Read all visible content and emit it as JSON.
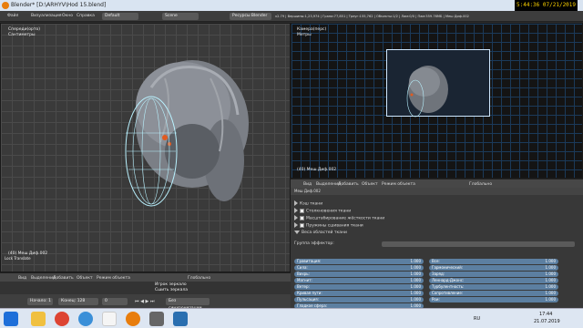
{
  "window": {
    "title": "Blender* [D:\\ARHYV\\Hod 15.blend]",
    "clock": "5:44:36  07/21/2019"
  },
  "menu": {
    "items": [
      "Файл",
      "Визуализация",
      "Окно",
      "Справка"
    ],
    "layout": "Default",
    "scene": "Scene",
    "engine": "Ресурсы Blender",
    "stats": "v2.79 | Вершины:1,23,974 | Грани:77,851 | Треуг:155,762 | Объекты:1/2 | Лам:0/0 | Пам:559.76МБ | Меш Диф.002"
  },
  "left_view": {
    "label_top": "Спереди(орто)",
    "label_sub": "Сантиметры",
    "label_object": "(40) Меш Диф.002",
    "transform_label": "Lock Translate"
  },
  "right_view": {
    "label_top": "Камера(перс)",
    "label_sub": "Метры",
    "label_object": "(40) Меш Диф.002"
  },
  "left_header": {
    "items": [
      "Вид",
      "Выделение",
      "Добавить",
      "Объект",
      "Режим объекта",
      "Глобально"
    ]
  },
  "right_header": {
    "items": [
      "Вид",
      "Выделение",
      "Добавить",
      "Объект",
      "Режим объекта",
      "Глобально"
    ]
  },
  "props": {
    "path": "Меш Диф.002",
    "sections": [
      "Кэш ткани",
      "Столкновения ткани",
      "Масштабирование жёсткости ткани",
      "Пружины сшивания ткани",
      "Веса областей ткани"
    ],
    "group_label": "Группа эффектор:",
    "fields_left": [
      {
        "label": "Гравитация:",
        "value": "1.000"
      },
      {
        "label": "Сила:",
        "value": "1.000"
      },
      {
        "label": "Вихрь:",
        "value": "1.000"
      },
      {
        "label": "Магнит:",
        "value": "1.000"
      },
      {
        "label": "Ветер:",
        "value": "1.000"
      },
      {
        "label": "Кривая пути:",
        "value": "1.000"
      },
      {
        "label": "Пульсация:",
        "value": "1.000"
      },
      {
        "label": "Гладкое сфера:",
        "value": "1.000"
      }
    ],
    "fields_right": [
      {
        "label": "Все:",
        "value": "1.000"
      },
      {
        "label": "Гармонический:",
        "value": "1.000"
      },
      {
        "label": "Заряд:",
        "value": "1.000"
      },
      {
        "label": "Леннард-Джонс:",
        "value": "1.000"
      },
      {
        "label": "Турбулентность:",
        "value": "1.000"
      },
      {
        "label": "Сопротивление:",
        "value": "1.000"
      },
      {
        "label": "Рои:",
        "value": "1.000"
      }
    ]
  },
  "timeline": {
    "start_label": "Начало:",
    "start": "1",
    "end_label": "Конец:",
    "end": "128",
    "frame": "0",
    "note1": "Игрок зеркало",
    "note2": "Сшить зеркала",
    "sync": "Без синхронизации"
  },
  "taskbar": {
    "lang": "RU",
    "time": "17:44",
    "date": "21.07.2019"
  },
  "colors": {
    "accent": "#5c7fa1",
    "blender_orange": "#e87d0d",
    "clock_bg": "#000000",
    "clock_fg": "#ffd400"
  }
}
